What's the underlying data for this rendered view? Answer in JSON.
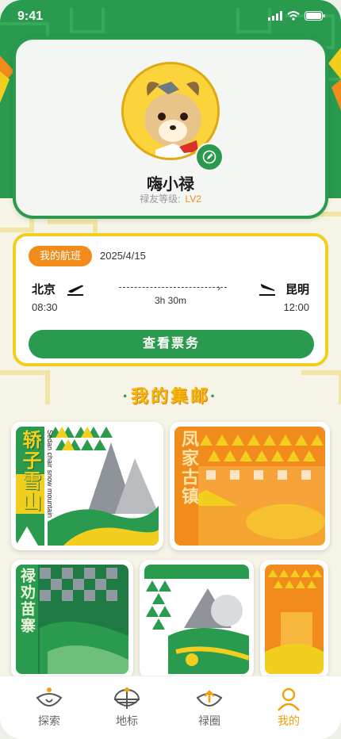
{
  "status_bar": {
    "time": "9:41"
  },
  "profile": {
    "username": "嗨小禄",
    "level_label": "禄友等级:",
    "level_value": "LV2"
  },
  "flight": {
    "tag": "我的航班",
    "date": "2025/4/15",
    "from_city": "北京",
    "to_city": "昆明",
    "depart_time": "08:30",
    "arrive_time": "12:00",
    "duration": "3h 30m",
    "ticket_button": "查看票务"
  },
  "stamps": {
    "title": "我的集邮",
    "items": [
      {
        "title": "轿子雪山",
        "subtitle": "Sedan chair snow mountain"
      },
      {
        "title": "凤家古镇",
        "subtitle": ""
      },
      {
        "title": "禄劝苗寨",
        "subtitle": ""
      },
      {
        "title": "",
        "subtitle": ""
      },
      {
        "title": "",
        "subtitle": ""
      }
    ]
  },
  "tabbar": {
    "items": [
      {
        "label": "探索",
        "icon": "explore-icon"
      },
      {
        "label": "地标",
        "icon": "landmark-icon"
      },
      {
        "label": "禄圈",
        "icon": "circle-icon"
      },
      {
        "label": "我的",
        "icon": "profile-icon"
      }
    ],
    "active": "我的"
  },
  "colors": {
    "green": "#2a9a4f",
    "yellow": "#f2cf1e",
    "orange": "#f08b1c"
  }
}
